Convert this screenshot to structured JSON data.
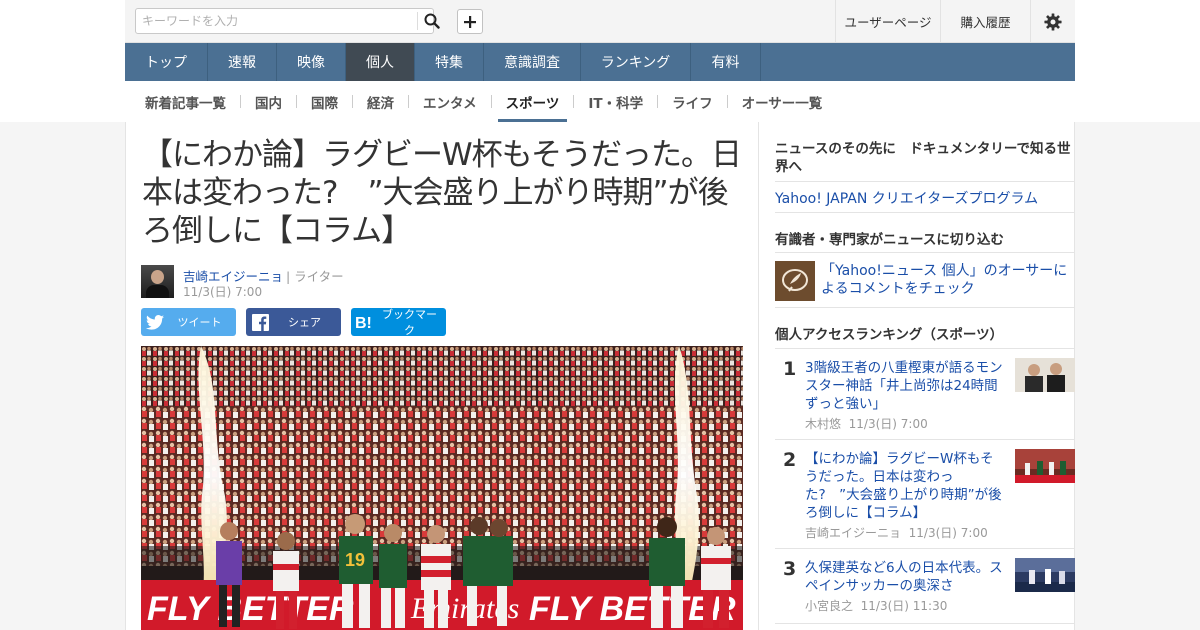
{
  "header": {
    "search_placeholder": "キーワードを入力",
    "user_page": "ユーザーページ",
    "purchase_history": "購入履歴"
  },
  "main_nav": {
    "items": [
      {
        "label": "トップ",
        "active": false
      },
      {
        "label": "速報",
        "active": false
      },
      {
        "label": "映像",
        "active": false
      },
      {
        "label": "個人",
        "active": true
      },
      {
        "label": "特集",
        "active": false
      },
      {
        "label": "意識調査",
        "active": false
      },
      {
        "label": "ランキング",
        "active": false
      },
      {
        "label": "有料",
        "active": false
      }
    ]
  },
  "sub_nav": {
    "items": [
      {
        "label": "新着記事一覧",
        "active": false
      },
      {
        "label": "国内",
        "active": false
      },
      {
        "label": "国際",
        "active": false
      },
      {
        "label": "経済",
        "active": false
      },
      {
        "label": "エンタメ",
        "active": false
      },
      {
        "label": "スポーツ",
        "active": true
      },
      {
        "label": "IT・科学",
        "active": false
      },
      {
        "label": "ライフ",
        "active": false
      },
      {
        "label": "オーサー一覧",
        "active": false
      }
    ]
  },
  "article": {
    "title": "【にわか論】ラグビーW杯もそうだった。日本は変わった?　”大会盛り上がり時期”が後ろ倒しに【コラム】",
    "author": "吉崎エイジーニョ",
    "role": "| ライター",
    "date": "11/3(日) 7:00",
    "share": {
      "twitter": "ツイート",
      "facebook": "シェア",
      "hatena": "ブックマーク"
    }
  },
  "sidebar": {
    "documentary_heading": "ニュースのその先に　ドキュメンタリーで知る世界へ",
    "creators_link": "Yahoo! JAPAN クリエイターズプログラム",
    "experts_heading": "有識者・専門家がニュースに切り込む",
    "experts_card": "「Yahoo!ニュース 個人」のオーサーによるコメントをチェック",
    "ranking_heading": "個人アクセスランキング（スポーツ）",
    "ranking": [
      {
        "rank": "1",
        "title": "3階級王者の八重樫東が語るモンスター神話「井上尚弥は24時間ずっと強い」",
        "author": "木村悠",
        "date": "11/3(日) 7:00"
      },
      {
        "rank": "2",
        "title": "【にわか論】ラグビーW杯もそうだった。日本は変わった?　”大会盛り上がり時期”が後ろ倒しに【コラム】",
        "author": "吉崎エイジーニョ",
        "date": "11/3(日) 7:00"
      },
      {
        "rank": "3",
        "title": "久保建英など6人の日本代表。スペインサッカーの奥深さ",
        "author": "小宮良之",
        "date": "11/3(日) 11:30"
      }
    ]
  },
  "photo": {
    "banner_text_1": "FLY BETTER",
    "banner_text_2": "Emirates",
    "banner_text_3": "FLY BETTER",
    "jersey_number": "19"
  }
}
